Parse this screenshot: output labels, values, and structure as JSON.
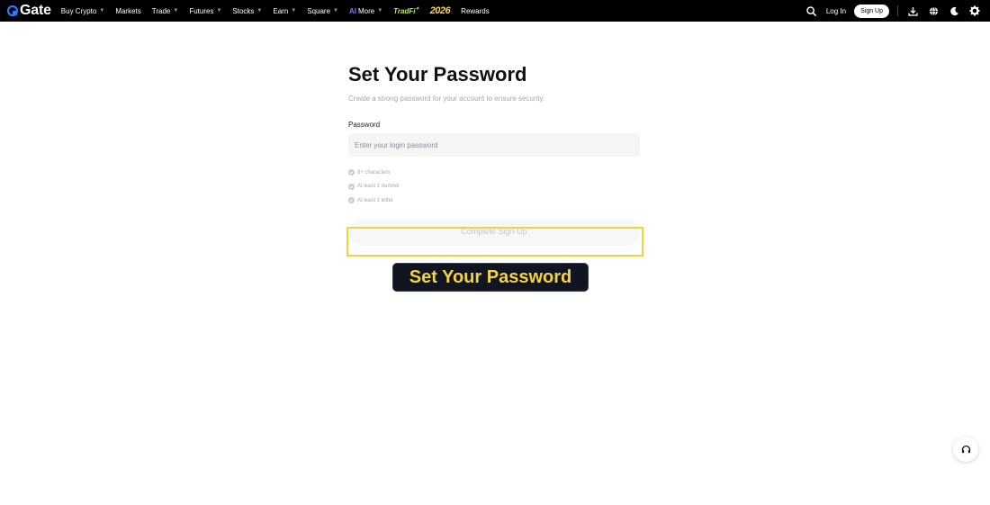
{
  "header": {
    "logo_text": "Gate",
    "nav": [
      {
        "label": "Buy Crypto",
        "has_caret": true
      },
      {
        "label": "Markets",
        "has_caret": false
      },
      {
        "label": "Trade",
        "has_caret": true
      },
      {
        "label": "Futures",
        "has_caret": true
      },
      {
        "label": "Stocks",
        "has_caret": true
      },
      {
        "label": "Earn",
        "has_caret": true
      },
      {
        "label": "Square",
        "has_caret": true
      },
      {
        "label": "More",
        "has_caret": true,
        "badge": "AI"
      },
      {
        "label": "TradFi",
        "has_caret": false
      },
      {
        "label": "2026",
        "has_caret": false
      },
      {
        "label": "Rewards",
        "has_caret": false
      }
    ],
    "login_label": "Log In",
    "signup_label": "Sign Up",
    "icons": [
      "search-icon",
      "download-icon",
      "globe-icon",
      "moon-icon",
      "gear-icon"
    ]
  },
  "form": {
    "title": "Set Your Password",
    "subtitle": "Create a strong password for your account to ensure security.",
    "password_label": "Password",
    "password_placeholder": "Enter your login password",
    "password_value": "",
    "rules": [
      "8+ characters",
      "At least 1 number",
      "At least 1 letter"
    ],
    "submit_label": "Complete Sign-Up"
  },
  "overlay": {
    "tooltip_text": "Set Your Password"
  },
  "colors": {
    "topbar": "#000000",
    "highlight": "#f2d43a",
    "tooltip_bg": "#10151f",
    "tooltip_text": "#f6d23d",
    "tradfi": "#b8f34d",
    "ai_badge": "#8a74ff"
  }
}
